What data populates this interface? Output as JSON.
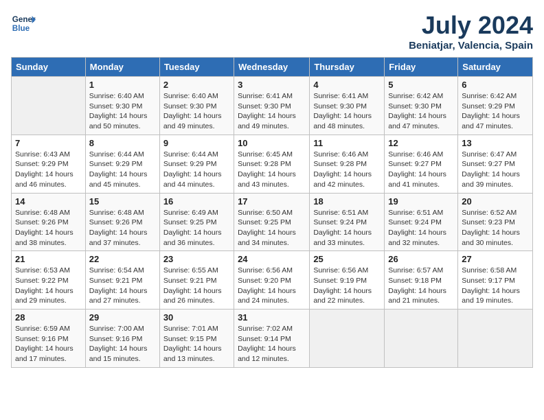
{
  "header": {
    "logo_line1": "General",
    "logo_line2": "Blue",
    "month_year": "July 2024",
    "location": "Beniatjar, Valencia, Spain"
  },
  "columns": [
    "Sunday",
    "Monday",
    "Tuesday",
    "Wednesday",
    "Thursday",
    "Friday",
    "Saturday"
  ],
  "weeks": [
    [
      {
        "day": "",
        "sunrise": "",
        "sunset": "",
        "daylight": ""
      },
      {
        "day": "1",
        "sunrise": "Sunrise: 6:40 AM",
        "sunset": "Sunset: 9:30 PM",
        "daylight": "Daylight: 14 hours and 50 minutes."
      },
      {
        "day": "2",
        "sunrise": "Sunrise: 6:40 AM",
        "sunset": "Sunset: 9:30 PM",
        "daylight": "Daylight: 14 hours and 49 minutes."
      },
      {
        "day": "3",
        "sunrise": "Sunrise: 6:41 AM",
        "sunset": "Sunset: 9:30 PM",
        "daylight": "Daylight: 14 hours and 49 minutes."
      },
      {
        "day": "4",
        "sunrise": "Sunrise: 6:41 AM",
        "sunset": "Sunset: 9:30 PM",
        "daylight": "Daylight: 14 hours and 48 minutes."
      },
      {
        "day": "5",
        "sunrise": "Sunrise: 6:42 AM",
        "sunset": "Sunset: 9:30 PM",
        "daylight": "Daylight: 14 hours and 47 minutes."
      },
      {
        "day": "6",
        "sunrise": "Sunrise: 6:42 AM",
        "sunset": "Sunset: 9:29 PM",
        "daylight": "Daylight: 14 hours and 47 minutes."
      }
    ],
    [
      {
        "day": "7",
        "sunrise": "Sunrise: 6:43 AM",
        "sunset": "Sunset: 9:29 PM",
        "daylight": "Daylight: 14 hours and 46 minutes."
      },
      {
        "day": "8",
        "sunrise": "Sunrise: 6:44 AM",
        "sunset": "Sunset: 9:29 PM",
        "daylight": "Daylight: 14 hours and 45 minutes."
      },
      {
        "day": "9",
        "sunrise": "Sunrise: 6:44 AM",
        "sunset": "Sunset: 9:29 PM",
        "daylight": "Daylight: 14 hours and 44 minutes."
      },
      {
        "day": "10",
        "sunrise": "Sunrise: 6:45 AM",
        "sunset": "Sunset: 9:28 PM",
        "daylight": "Daylight: 14 hours and 43 minutes."
      },
      {
        "day": "11",
        "sunrise": "Sunrise: 6:46 AM",
        "sunset": "Sunset: 9:28 PM",
        "daylight": "Daylight: 14 hours and 42 minutes."
      },
      {
        "day": "12",
        "sunrise": "Sunrise: 6:46 AM",
        "sunset": "Sunset: 9:27 PM",
        "daylight": "Daylight: 14 hours and 41 minutes."
      },
      {
        "day": "13",
        "sunrise": "Sunrise: 6:47 AM",
        "sunset": "Sunset: 9:27 PM",
        "daylight": "Daylight: 14 hours and 39 minutes."
      }
    ],
    [
      {
        "day": "14",
        "sunrise": "Sunrise: 6:48 AM",
        "sunset": "Sunset: 9:26 PM",
        "daylight": "Daylight: 14 hours and 38 minutes."
      },
      {
        "day": "15",
        "sunrise": "Sunrise: 6:48 AM",
        "sunset": "Sunset: 9:26 PM",
        "daylight": "Daylight: 14 hours and 37 minutes."
      },
      {
        "day": "16",
        "sunrise": "Sunrise: 6:49 AM",
        "sunset": "Sunset: 9:25 PM",
        "daylight": "Daylight: 14 hours and 36 minutes."
      },
      {
        "day": "17",
        "sunrise": "Sunrise: 6:50 AM",
        "sunset": "Sunset: 9:25 PM",
        "daylight": "Daylight: 14 hours and 34 minutes."
      },
      {
        "day": "18",
        "sunrise": "Sunrise: 6:51 AM",
        "sunset": "Sunset: 9:24 PM",
        "daylight": "Daylight: 14 hours and 33 minutes."
      },
      {
        "day": "19",
        "sunrise": "Sunrise: 6:51 AM",
        "sunset": "Sunset: 9:24 PM",
        "daylight": "Daylight: 14 hours and 32 minutes."
      },
      {
        "day": "20",
        "sunrise": "Sunrise: 6:52 AM",
        "sunset": "Sunset: 9:23 PM",
        "daylight": "Daylight: 14 hours and 30 minutes."
      }
    ],
    [
      {
        "day": "21",
        "sunrise": "Sunrise: 6:53 AM",
        "sunset": "Sunset: 9:22 PM",
        "daylight": "Daylight: 14 hours and 29 minutes."
      },
      {
        "day": "22",
        "sunrise": "Sunrise: 6:54 AM",
        "sunset": "Sunset: 9:21 PM",
        "daylight": "Daylight: 14 hours and 27 minutes."
      },
      {
        "day": "23",
        "sunrise": "Sunrise: 6:55 AM",
        "sunset": "Sunset: 9:21 PM",
        "daylight": "Daylight: 14 hours and 26 minutes."
      },
      {
        "day": "24",
        "sunrise": "Sunrise: 6:56 AM",
        "sunset": "Sunset: 9:20 PM",
        "daylight": "Daylight: 14 hours and 24 minutes."
      },
      {
        "day": "25",
        "sunrise": "Sunrise: 6:56 AM",
        "sunset": "Sunset: 9:19 PM",
        "daylight": "Daylight: 14 hours and 22 minutes."
      },
      {
        "day": "26",
        "sunrise": "Sunrise: 6:57 AM",
        "sunset": "Sunset: 9:18 PM",
        "daylight": "Daylight: 14 hours and 21 minutes."
      },
      {
        "day": "27",
        "sunrise": "Sunrise: 6:58 AM",
        "sunset": "Sunset: 9:17 PM",
        "daylight": "Daylight: 14 hours and 19 minutes."
      }
    ],
    [
      {
        "day": "28",
        "sunrise": "Sunrise: 6:59 AM",
        "sunset": "Sunset: 9:16 PM",
        "daylight": "Daylight: 14 hours and 17 minutes."
      },
      {
        "day": "29",
        "sunrise": "Sunrise: 7:00 AM",
        "sunset": "Sunset: 9:16 PM",
        "daylight": "Daylight: 14 hours and 15 minutes."
      },
      {
        "day": "30",
        "sunrise": "Sunrise: 7:01 AM",
        "sunset": "Sunset: 9:15 PM",
        "daylight": "Daylight: 14 hours and 13 minutes."
      },
      {
        "day": "31",
        "sunrise": "Sunrise: 7:02 AM",
        "sunset": "Sunset: 9:14 PM",
        "daylight": "Daylight: 14 hours and 12 minutes."
      },
      {
        "day": "",
        "sunrise": "",
        "sunset": "",
        "daylight": ""
      },
      {
        "day": "",
        "sunrise": "",
        "sunset": "",
        "daylight": ""
      },
      {
        "day": "",
        "sunrise": "",
        "sunset": "",
        "daylight": ""
      }
    ]
  ]
}
